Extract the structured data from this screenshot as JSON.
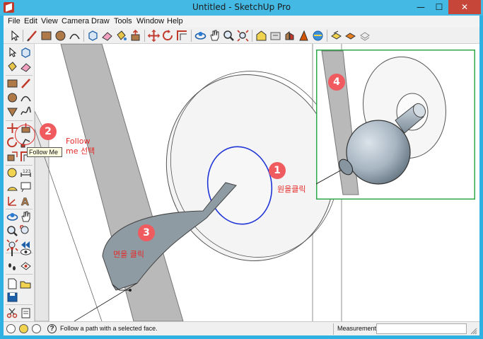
{
  "window": {
    "title": "Untitled - SketchUp Pro",
    "minimize_glyph": "—",
    "maximize_glyph": "☐",
    "close_glyph": "✕"
  },
  "menu": [
    "File",
    "Edit",
    "View",
    "Camera",
    "Draw",
    "Tools",
    "Window",
    "Help"
  ],
  "toolbar_icons": [
    "select-tool-icon",
    "line-tool-icon",
    "rectangle-tool-icon",
    "circle-tool-icon",
    "arc-tool-icon",
    "make-component-icon",
    "eraser-tool-icon",
    "paint-bucket-icon",
    "push-pull-icon",
    "move-tool-icon",
    "rotate-tool-icon",
    "offset-tool-icon",
    "orbit-tool-icon",
    "pan-tool-icon",
    "zoom-tool-icon",
    "zoom-extents-icon",
    "warehouse-icon",
    "share-model-icon",
    "component-icon",
    "extension-icon",
    "layout-icon",
    "style-icon",
    "section-icon"
  ],
  "tooltip": "Follow Me",
  "status": {
    "hint": "Follow a path with a selected face.",
    "help_glyph": "?",
    "measurements_label": "Measurements",
    "measurements_value": ""
  },
  "annotations": {
    "badge_1": "1",
    "badge_2": "2",
    "badge_3": "3",
    "badge_4": "4",
    "note_1": "원을클릭",
    "note_2_line1": "Follow",
    "note_2_line2": "me 선택",
    "note_3": "면을 클릭"
  },
  "colors": {
    "title_bar": "#43b9e4",
    "accent_red": "#ef5b5e",
    "note_red": "#e42a27",
    "highlight_green": "#2ea84a",
    "selection_blue": "#1f35d6",
    "face_gray": "#8f9ba3"
  }
}
